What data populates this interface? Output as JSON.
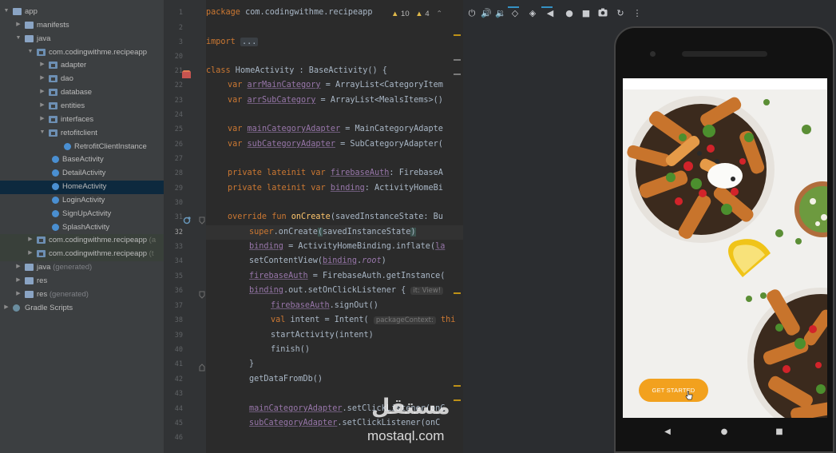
{
  "project_tree": {
    "rows": [
      {
        "label": "app",
        "type": "module-folder",
        "expanded": true
      },
      {
        "label": "manifests",
        "type": "folder",
        "expanded": false
      },
      {
        "label": "java",
        "type": "folder",
        "expanded": true
      },
      {
        "label": "com.codingwithme.recipeapp",
        "type": "package",
        "expanded": true
      },
      {
        "label": "adapter",
        "type": "package",
        "expanded": false
      },
      {
        "label": "dao",
        "type": "package",
        "expanded": false
      },
      {
        "label": "database",
        "type": "package",
        "expanded": false
      },
      {
        "label": "entities",
        "type": "package",
        "expanded": false
      },
      {
        "label": "interfaces",
        "type": "package",
        "expanded": false
      },
      {
        "label": "retofitclient",
        "type": "package",
        "expanded": true
      },
      {
        "label": "RetrofitClientInstance",
        "type": "class"
      },
      {
        "label": "BaseActivity",
        "type": "class"
      },
      {
        "label": "DetailActivity",
        "type": "class"
      },
      {
        "label": "HomeActivity",
        "type": "class",
        "selected": true
      },
      {
        "label": "LoginActivity",
        "type": "class"
      },
      {
        "label": "SignUpActivity",
        "type": "class"
      },
      {
        "label": "SplashActivity",
        "type": "class"
      },
      {
        "label": "com.codingwithme.recipeapp",
        "type": "package",
        "expanded": false,
        "tag": "(a"
      },
      {
        "label": "com.codingwithme.recipeapp",
        "type": "package",
        "expanded": false,
        "tag": "(t"
      },
      {
        "label": "java",
        "type": "folder",
        "expanded": false,
        "tag": "(generated)"
      },
      {
        "label": "res",
        "type": "folder",
        "expanded": false
      },
      {
        "label": "res",
        "type": "folder",
        "expanded": false,
        "tag": "(generated)"
      },
      {
        "label": "Gradle Scripts",
        "type": "gradle",
        "expanded": false
      }
    ]
  },
  "editor": {
    "warnings": {
      "warning_count": "10",
      "weak_warning_count": "4"
    },
    "line_numbers": [
      "1",
      "2",
      "3",
      "20",
      "21",
      "22",
      "23",
      "24",
      "25",
      "26",
      "27",
      "28",
      "29",
      "30",
      "31",
      "32",
      "33",
      "34",
      "35",
      "36",
      "37",
      "38",
      "39",
      "40",
      "41",
      "42",
      "43",
      "44",
      "45",
      "46"
    ],
    "current_line": "32",
    "lines": {
      "l1": {
        "kw": "package",
        "text": " com.codingwithme.recipeapp"
      },
      "l3": {
        "kw": "import",
        "fold": "..."
      },
      "l21": {
        "kw": "class",
        "name": " HomeActivity",
        "rest": " : BaseActivity() {"
      },
      "l22": {
        "kw": "var",
        "prop": "arrMainCategory",
        "rest": " = ArrayList<CategoryItem"
      },
      "l23": {
        "kw": "var",
        "prop": "arrSubCategory",
        "rest": " = ArrayList<MealsItems>()"
      },
      "l25": {
        "kw": "var",
        "prop": "mainCategoryAdapter",
        "rest": " = MainCategoryAdapte"
      },
      "l26": {
        "kw": "var",
        "prop": "subCategoryAdapter",
        "rest": " = SubCategoryAdapter("
      },
      "l28": {
        "kw": "private lateinit var",
        "prop": "firebaseAuth",
        "rest": ": FirebaseA"
      },
      "l29": {
        "kw": "private lateinit var",
        "prop": "binding",
        "rest": ": ActivityHomeBi"
      },
      "l31": {
        "kw": "override fun",
        "fn": "onCreate",
        "rest": "(savedInstanceState: Bu"
      },
      "l32": {
        "kw": "super",
        "pre": ".onCreate",
        "brace_open": "(",
        "mid": "savedInstanceState",
        "brace_close": ")"
      },
      "l33": {
        "prop": "binding",
        "rest": " = ActivityHomeBinding.inflate(",
        "tail": "la"
      },
      "l34": {
        "pre": "setContentView(",
        "prop": "binding",
        "mid": ".",
        "prop2": "root",
        "rest": ")"
      },
      "l35": {
        "prop": "firebaseAuth",
        "rest": " = FirebaseAuth.getInstance("
      },
      "l36": {
        "prop": "binding",
        "rest": ".out.setOnClickListener { ",
        "hint": "it: View!"
      },
      "l37": {
        "prop": "firebaseAuth",
        "rest": ".signOut()"
      },
      "l38": {
        "kw": "val",
        "pre": " intent = Intent( ",
        "hint": "packageContext:",
        "rest": " thi"
      },
      "l39": {
        "text": "startActivity(intent)"
      },
      "l40": {
        "text": "finish()"
      },
      "l41": {
        "text": "}"
      },
      "l42": {
        "text": "getDataFromDb()"
      },
      "l44": {
        "prop": "mainCategoryAdapter",
        "rest": ".setClickListener(onC"
      },
      "l45": {
        "prop": "subCategoryAdapter",
        "rest": ".setClickListener(onC"
      }
    }
  },
  "emulator": {
    "toolbar_icons": [
      "power-icon",
      "volume-up-icon",
      "volume-down-icon",
      "rotate-left-icon",
      "rotate-right-icon",
      "back-icon",
      "home-icon",
      "overview-icon",
      "screenshot-icon",
      "replay-icon",
      "more-icon"
    ],
    "app": {
      "get_started_label": "GET STARTED",
      "accent_color": "#f2a11e"
    },
    "nav_icons": [
      "nav-back-icon",
      "nav-home-icon",
      "nav-recents-icon"
    ]
  },
  "watermark": {
    "arabic": "مستقل",
    "latin": "mostaql.com"
  },
  "colors": {
    "keyword": "#cc7832",
    "function": "#ffc66d",
    "property": "#9876aa",
    "text": "#a9b7c6",
    "selection": "#0d293e"
  }
}
